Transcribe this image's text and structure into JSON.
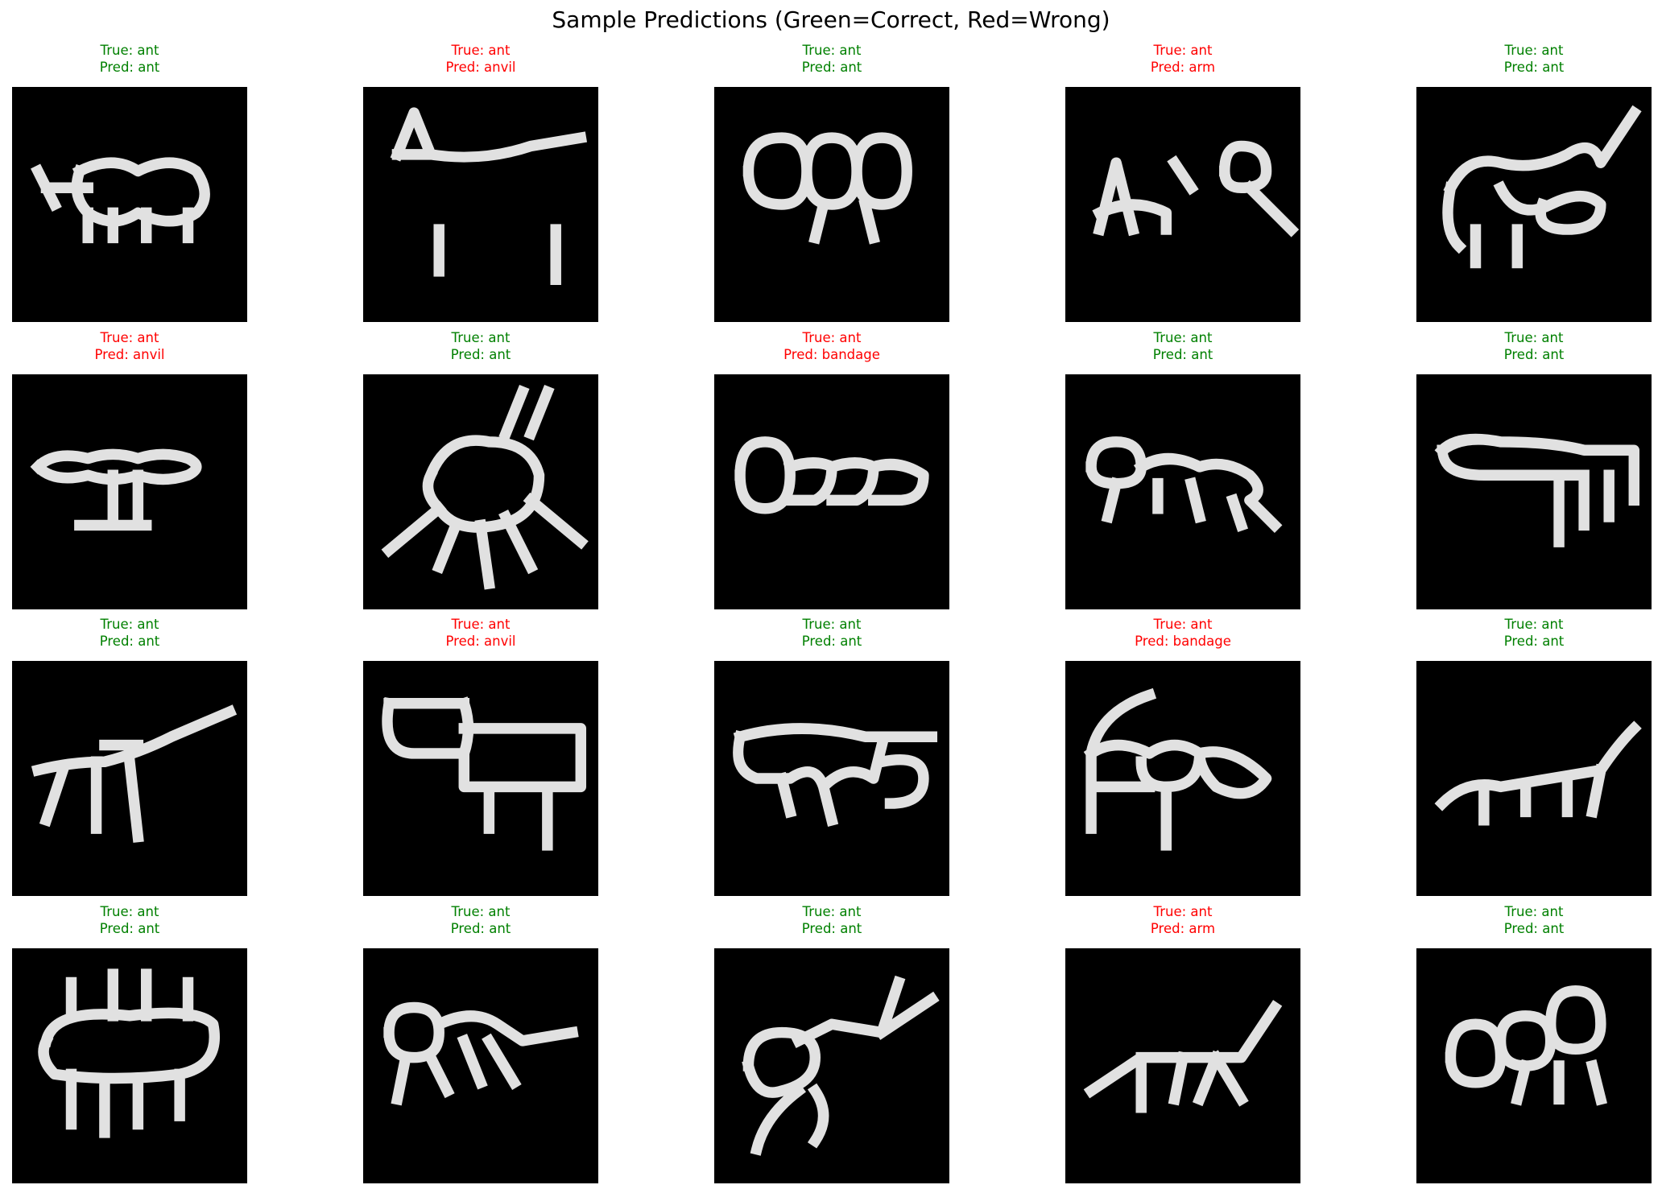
{
  "title": "Sample Predictions (Green=Correct, Red=Wrong)",
  "colors": {
    "correct": "#008000",
    "wrong": "#ff0000",
    "stroke": "#ededed",
    "background": "#000000"
  },
  "chart_data": {
    "type": "image-grid",
    "title": "Sample Predictions (Green=Correct, Red=Wrong)",
    "rows": 4,
    "cols": 5,
    "samples": [
      {
        "true": "True: ant",
        "pred": "Pred: ant",
        "correct": true,
        "icon": "ant-doodle"
      },
      {
        "true": "True: ant",
        "pred": "Pred: anvil",
        "correct": false,
        "icon": "ant-doodle"
      },
      {
        "true": "True: ant",
        "pred": "Pred: ant",
        "correct": true,
        "icon": "ant-doodle"
      },
      {
        "true": "True: ant",
        "pred": "Pred: arm",
        "correct": false,
        "icon": "ant-doodle"
      },
      {
        "true": "True: ant",
        "pred": "Pred: ant",
        "correct": true,
        "icon": "ant-doodle"
      },
      {
        "true": "True: ant",
        "pred": "Pred: anvil",
        "correct": false,
        "icon": "ant-doodle"
      },
      {
        "true": "True: ant",
        "pred": "Pred: ant",
        "correct": true,
        "icon": "ant-doodle"
      },
      {
        "true": "True: ant",
        "pred": "Pred: bandage",
        "correct": false,
        "icon": "ant-doodle"
      },
      {
        "true": "True: ant",
        "pred": "Pred: ant",
        "correct": true,
        "icon": "ant-doodle"
      },
      {
        "true": "True: ant",
        "pred": "Pred: ant",
        "correct": true,
        "icon": "ant-doodle"
      },
      {
        "true": "True: ant",
        "pred": "Pred: ant",
        "correct": true,
        "icon": "ant-doodle"
      },
      {
        "true": "True: ant",
        "pred": "Pred: anvil",
        "correct": false,
        "icon": "ant-doodle"
      },
      {
        "true": "True: ant",
        "pred": "Pred: ant",
        "correct": true,
        "icon": "ant-doodle"
      },
      {
        "true": "True: ant",
        "pred": "Pred: bandage",
        "correct": false,
        "icon": "ant-doodle"
      },
      {
        "true": "True: ant",
        "pred": "Pred: ant",
        "correct": true,
        "icon": "ant-doodle"
      },
      {
        "true": "True: ant",
        "pred": "Pred: ant",
        "correct": true,
        "icon": "ant-doodle"
      },
      {
        "true": "True: ant",
        "pred": "Pred: ant",
        "correct": true,
        "icon": "ant-doodle"
      },
      {
        "true": "True: ant",
        "pred": "Pred: ant",
        "correct": true,
        "icon": "ant-doodle"
      },
      {
        "true": "True: ant",
        "pred": "Pred: arm",
        "correct": false,
        "icon": "ant-doodle"
      },
      {
        "true": "True: ant",
        "pred": "Pred: ant",
        "correct": true,
        "icon": "ant-doodle"
      }
    ]
  }
}
